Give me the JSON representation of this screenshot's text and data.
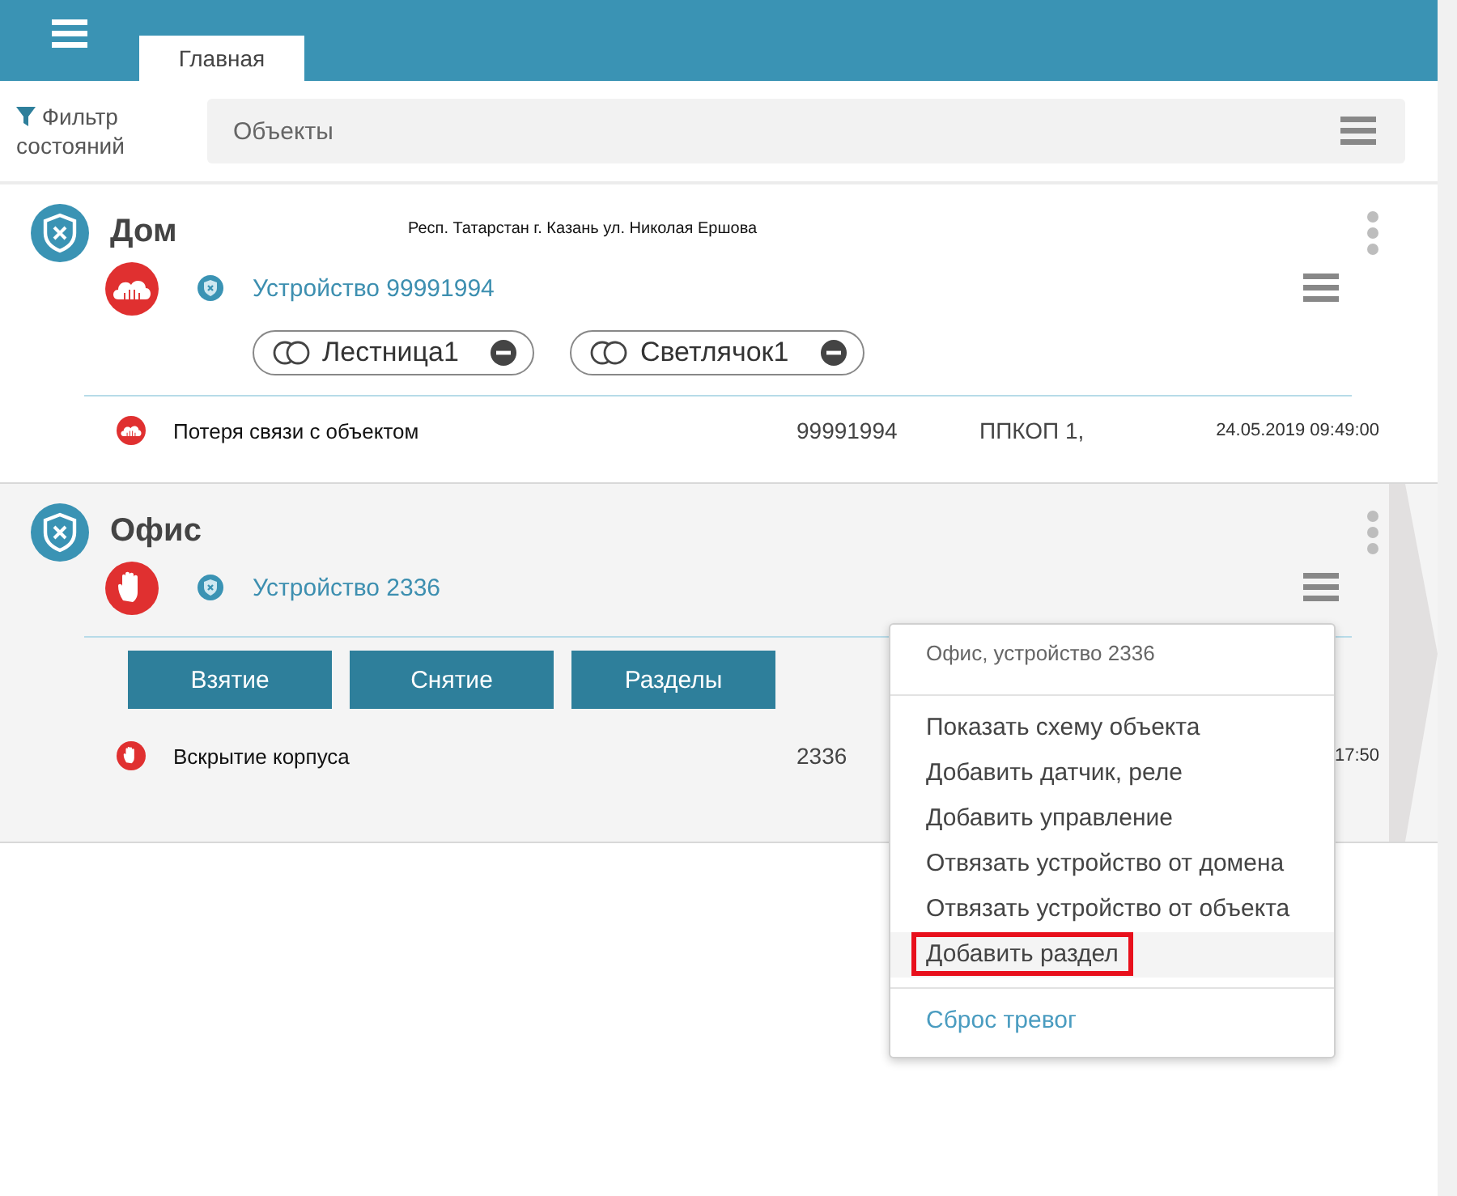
{
  "header": {
    "tabs": [
      {
        "label": "Главная",
        "selected": true
      }
    ]
  },
  "filter": {
    "label": "Фильтр состояний"
  },
  "search": {
    "placeholder": "Объекты"
  },
  "objects": [
    {
      "name": "Дом",
      "address": "Респ. Татарстан г. Казань ул. Николая Ершова",
      "kind": "connection_lost",
      "device": "Устройство 99991994",
      "selected": false,
      "zones": [
        {
          "label": "Лестница1"
        },
        {
          "label": "Светлячок1"
        }
      ],
      "events": [
        {
          "kind": "connection_lost",
          "text": "Потеря связи с объектом",
          "code": "99991994",
          "device_type": "ППКОП 1,",
          "time": "24.05.2019 09:49:00"
        }
      ]
    },
    {
      "name": "Офис",
      "kind": "tamper",
      "device": "Устройство 2336",
      "selected": true,
      "actions": [
        "Взятие",
        "Снятие",
        "Разделы"
      ],
      "events": [
        {
          "kind": "tamper",
          "text": "Вскрытие корпуса",
          "code": "2336",
          "time": "17:50"
        }
      ]
    }
  ],
  "menu": {
    "title": "Офис, устройство 2336",
    "items": [
      {
        "label": "Показать схему объекта",
        "kind": "action",
        "highlighted": false
      },
      {
        "label": "Добавить датчик, реле",
        "kind": "action",
        "highlighted": false
      },
      {
        "label": "Добавить управление",
        "kind": "action",
        "highlighted": false
      },
      {
        "label": "Отвязать устройство от домена",
        "kind": "action",
        "highlighted": false
      },
      {
        "label": "Отвязать устройство от объекта",
        "kind": "action",
        "highlighted": false
      },
      {
        "label": "Добавить раздел",
        "kind": "action",
        "highlighted": true
      },
      {
        "label": "Сброс тревог",
        "kind": "link",
        "highlighted": false
      }
    ]
  }
}
